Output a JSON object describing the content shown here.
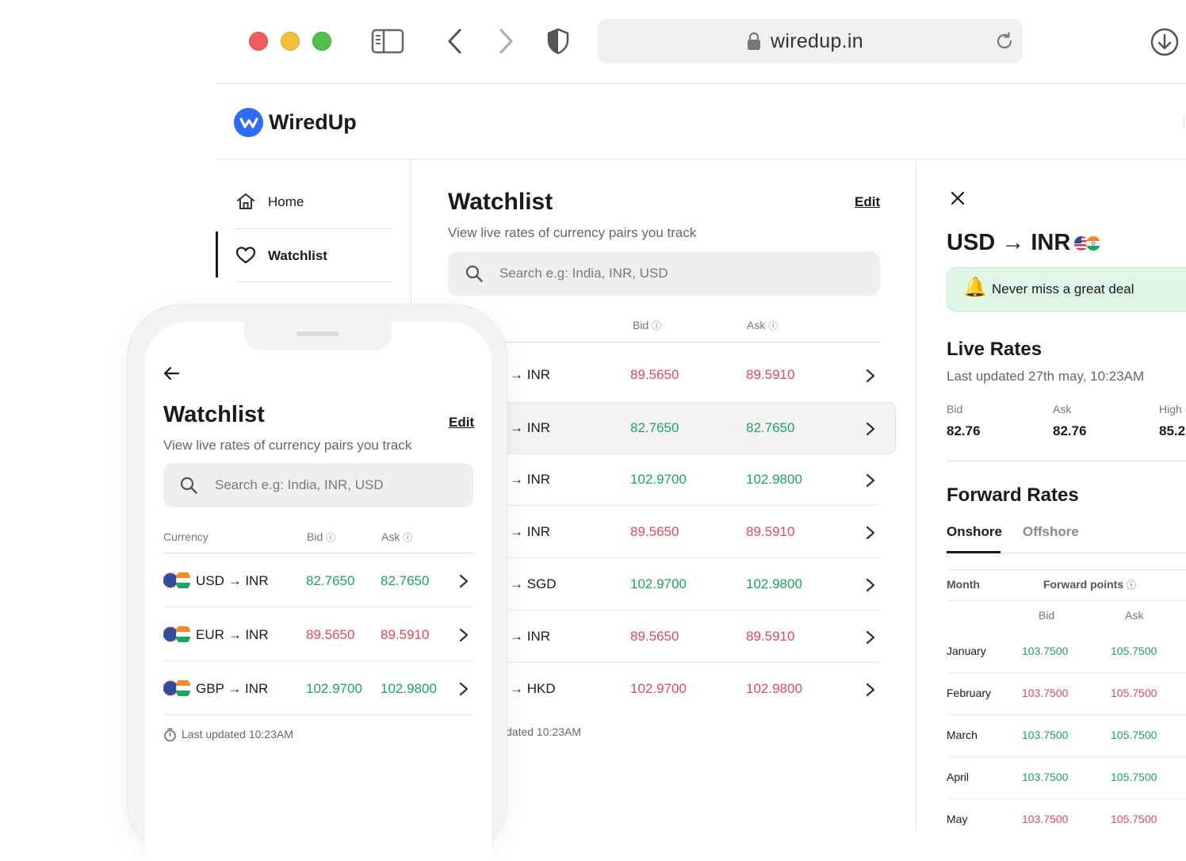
{
  "browser": {
    "url": "wiredup.in",
    "colors": {
      "close": "#ee5f5b",
      "minimize": "#f5bf3c",
      "maximize": "#4fc04a"
    }
  },
  "app": {
    "name": "WiredUp",
    "brand_color": "#2f6cf5",
    "sidebar": {
      "items": [
        {
          "label": "Home",
          "icon": "home-icon"
        },
        {
          "label": "Watchlist",
          "icon": "heart-icon",
          "active": true
        }
      ]
    }
  },
  "watchlist": {
    "title": "Watchlist",
    "subtitle": "View live rates of currency pairs you track",
    "edit_label": "Edit",
    "search_placeholder": "Search e.g: India, INR, USD",
    "columns": {
      "bid": "Bid",
      "ask": "Ask"
    },
    "rows": [
      {
        "pair": "→ INR",
        "bid": "89.5650",
        "ask": "89.5910",
        "trend": "down"
      },
      {
        "pair": "→ INR",
        "bid": "82.7650",
        "ask": "82.7650",
        "trend": "up",
        "selected": true
      },
      {
        "pair": "→ INR",
        "bid": "102.9700",
        "ask": "102.9800",
        "trend": "up"
      },
      {
        "pair": "→ INR",
        "bid": "89.5650",
        "ask": "89.5910",
        "trend": "down"
      },
      {
        "pair": "→ SGD",
        "bid": "102.9700",
        "ask": "102.9800",
        "trend": "up"
      },
      {
        "pair": "→ INR",
        "bid": "89.5650",
        "ask": "89.5910",
        "trend": "down"
      },
      {
        "pair": "→ HKD",
        "bid": "102.9700",
        "ask": "102.9800",
        "trend": "down"
      }
    ],
    "last_updated": "dated 10:23AM"
  },
  "detail": {
    "pair_title": "USD → INR",
    "alert_text": "Never miss a great deal",
    "live_title": "Live Rates",
    "live_updated": "Last updated 27th may, 10:23AM",
    "stats": [
      {
        "label": "Bid",
        "value": "82.76"
      },
      {
        "label": "Ask",
        "value": "82.76"
      },
      {
        "label": "High",
        "value": "85.2"
      }
    ],
    "forward_title": "Forward Rates",
    "tabs": [
      {
        "label": "Onshore",
        "active": true
      },
      {
        "label": "Offshore",
        "active": false
      }
    ],
    "table_headers": {
      "month": "Month",
      "points": "Forward points",
      "bid": "Bid",
      "ask": "Ask"
    },
    "forward_rows": [
      {
        "month": "January",
        "bid": "103.7500",
        "ask": "105.7500",
        "trend": "up"
      },
      {
        "month": "February",
        "bid": "103.7500",
        "ask": "105.7500",
        "trend": "down"
      },
      {
        "month": "March",
        "bid": "103.7500",
        "ask": "105.7500",
        "trend": "up"
      },
      {
        "month": "April",
        "bid": "103.7500",
        "ask": "105.7500",
        "trend": "up"
      },
      {
        "month": "May",
        "bid": "103.7500",
        "ask": "105.7500",
        "trend": "down"
      }
    ]
  },
  "mobile": {
    "title": "Watchlist",
    "edit_label": "Edit",
    "subtitle": "View live rates of currency pairs you track",
    "search_placeholder": "Search e.g: India, INR, USD",
    "columns": {
      "currency": "Currency",
      "bid": "Bid",
      "ask": "Ask"
    },
    "rows": [
      {
        "pair": "USD → INR",
        "bid": "82.7650",
        "ask": "82.7650",
        "trend": "up"
      },
      {
        "pair": "EUR → INR",
        "bid": "89.5650",
        "ask": "89.5910",
        "trend": "down"
      },
      {
        "pair": "GBP → INR",
        "bid": "102.9700",
        "ask": "102.9800",
        "trend": "up"
      }
    ],
    "last_updated": "Last updated 10:23AM"
  }
}
